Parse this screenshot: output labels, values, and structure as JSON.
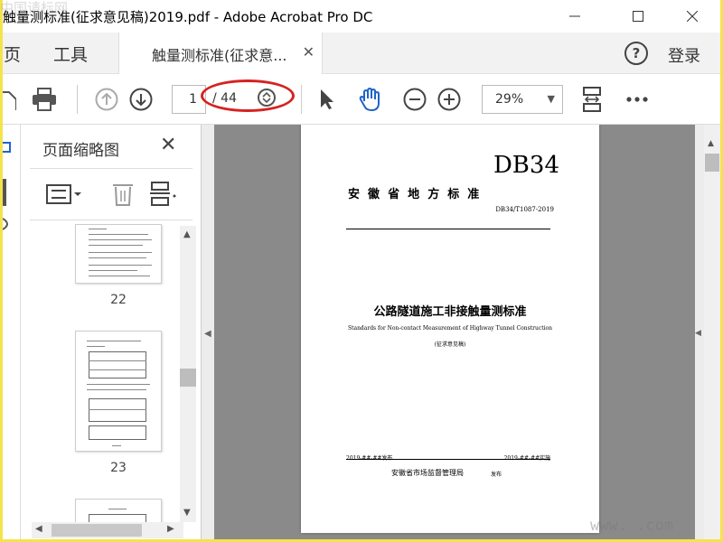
{
  "window": {
    "title": "触量测标准(征求意见稿)2019.pdf - Adobe Acrobat Pro DC"
  },
  "tabs": {
    "home": "主页",
    "tools": "工具",
    "document": "触量测标准(征求意...",
    "help": "?",
    "login": "登录"
  },
  "toolbar": {
    "current_page": "1",
    "total_pages": "/ 44",
    "zoom": "29%"
  },
  "panel": {
    "title": "页面缩略图",
    "thumbnails": [
      {
        "page": "22"
      },
      {
        "page": "23"
      }
    ]
  },
  "document": {
    "code": "DB34",
    "standard_type": "安  徽  省  地  方  标  准",
    "standard_number": "DB34/T1087-2019",
    "title_cn": "公路隧道施工非接触量测标准",
    "title_en": "Standards for Non-contact Measurement of Highway Tunnel Construction",
    "draft_note": "(征求意见稿)",
    "issue_date": "2019-##-##发布",
    "impl_date": "2019-##-##实施",
    "issuer": "安徽省市场监督管理局",
    "issuer_suffix": "发布"
  },
  "watermark": {
    "top_left": "中国请标网",
    "bottom_right": "www.    .com"
  },
  "colors": {
    "annotation_red": "#d62222",
    "frame_yellow": "#f5e34a",
    "hand_tool_blue": "#1e64c8"
  }
}
